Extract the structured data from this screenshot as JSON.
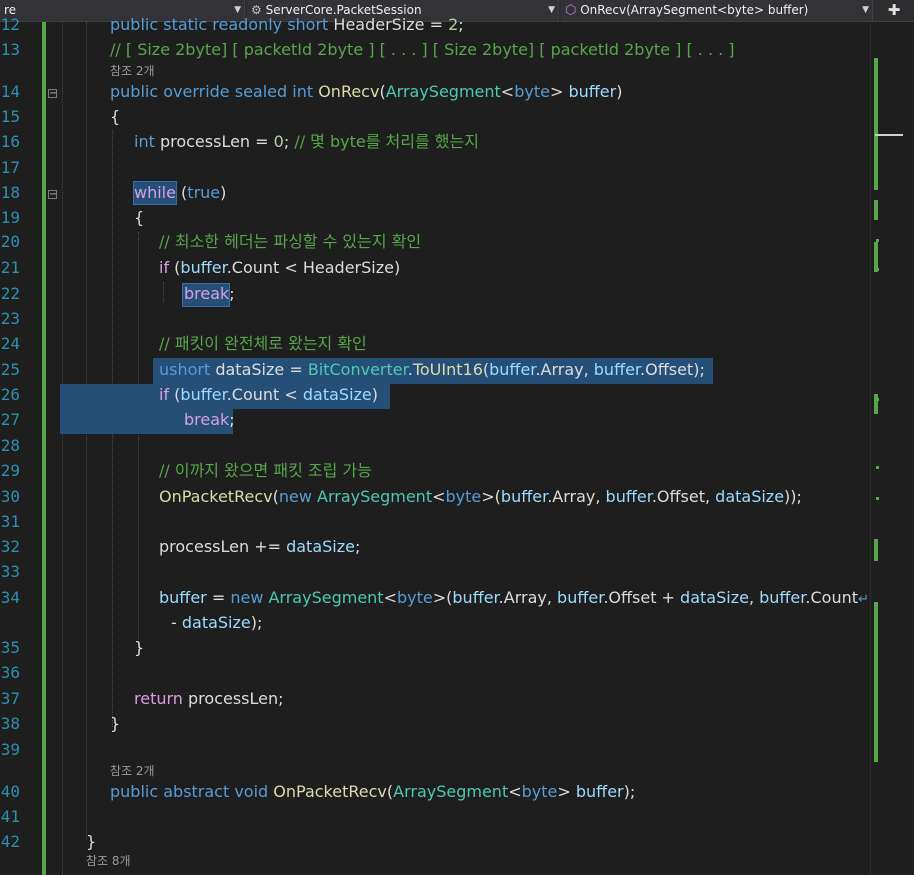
{
  "navbar": {
    "project": "re",
    "class_scope": "ServerCore.PacketSession",
    "member_scope": "OnRecv(ArraySegment<byte> buffer)",
    "split_icon": "split-view-icon"
  },
  "code_lens": {
    "ref2": "참조 2개",
    "ref8": "참조 8개"
  },
  "lines": [
    {
      "n": "12",
      "parts": [
        [
          "kw",
          "public static readonly short "
        ],
        [
          "",
          "HeaderSize = "
        ],
        [
          "nm",
          "2"
        ],
        [
          "",
          ";"
        ]
      ]
    },
    {
      "n": "13",
      "parts": [
        [
          "cm",
          "// [ Size 2byte] [ packetId 2byte ] [ . . . ] [ Size 2byte] [ packetId 2byte ] [ . . . ]"
        ]
      ]
    },
    {
      "n": "14",
      "parts": [
        [
          "kw",
          "public override sealed int "
        ],
        [
          "mt",
          "OnRecv"
        ],
        [
          "",
          "("
        ],
        [
          "ty",
          "ArraySegment"
        ],
        [
          "",
          "<"
        ],
        [
          "kw",
          "byte"
        ],
        [
          "",
          "> "
        ],
        [
          "pa",
          "buffer"
        ],
        [
          "",
          ")"
        ]
      ]
    },
    {
      "n": "15",
      "parts": [
        [
          "",
          "{"
        ]
      ]
    },
    {
      "n": "16",
      "parts": [
        [
          "kw",
          "int "
        ],
        [
          "",
          "processLen = "
        ],
        [
          "nm",
          "0"
        ],
        [
          "",
          "; "
        ],
        [
          "cm",
          "// 몇 byte를 처리를 했는지"
        ]
      ]
    },
    {
      "n": "17",
      "parts": []
    },
    {
      "n": "18",
      "parts": [
        [
          "kc",
          "while"
        ],
        [
          "",
          " ("
        ],
        [
          "kw",
          "true"
        ],
        [
          "",
          ")"
        ]
      ]
    },
    {
      "n": "19",
      "parts": [
        [
          "",
          "{"
        ]
      ]
    },
    {
      "n": "20",
      "parts": [
        [
          "cm",
          "// 최소한 헤더는 파싱할 수 있는지 확인"
        ]
      ]
    },
    {
      "n": "21",
      "parts": [
        [
          "kc",
          "if"
        ],
        [
          "",
          " ("
        ],
        [
          "pa",
          "buffer"
        ],
        [
          "",
          ".Count < HeaderSize)"
        ]
      ]
    },
    {
      "n": "22",
      "parts": [
        [
          "kc",
          "break"
        ],
        [
          "",
          ";"
        ]
      ]
    },
    {
      "n": "23",
      "parts": []
    },
    {
      "n": "24",
      "parts": [
        [
          "cm",
          "// 패킷이 완전체로 왔는지 확인"
        ]
      ]
    },
    {
      "n": "25",
      "parts": [
        [
          "kw",
          "ushort "
        ],
        [
          "",
          "dataSize = "
        ],
        [
          "ty",
          "BitConverter"
        ],
        [
          "",
          "."
        ],
        [
          "mt",
          "ToUInt16"
        ],
        [
          "",
          "("
        ],
        [
          "pa",
          "buffer"
        ],
        [
          "",
          ".Array, "
        ],
        [
          "pa",
          "buffer"
        ],
        [
          "",
          ".Offset);"
        ]
      ]
    },
    {
      "n": "26",
      "parts": [
        [
          "kc",
          "if"
        ],
        [
          "",
          " ("
        ],
        [
          "pa",
          "buffer"
        ],
        [
          "",
          ".Count < "
        ],
        [
          "pa",
          "dataSize"
        ],
        [
          "",
          ")"
        ]
      ]
    },
    {
      "n": "27",
      "parts": [
        [
          "kc",
          "break"
        ],
        [
          "",
          ";"
        ]
      ]
    },
    {
      "n": "28",
      "parts": []
    },
    {
      "n": "29",
      "parts": [
        [
          "cm",
          "// 이까지 왔으면 패킷 조립 가능"
        ]
      ]
    },
    {
      "n": "30",
      "parts": [
        [
          "mt",
          "OnPacketRecv"
        ],
        [
          "",
          "("
        ],
        [
          "kw",
          "new "
        ],
        [
          "ty",
          "ArraySegment"
        ],
        [
          "",
          "<"
        ],
        [
          "kw",
          "byte"
        ],
        [
          "",
          ">("
        ],
        [
          "pa",
          "buffer"
        ],
        [
          "",
          ".Array, "
        ],
        [
          "pa",
          "buffer"
        ],
        [
          "",
          ".Offset, "
        ],
        [
          "pa",
          "dataSize"
        ],
        [
          "",
          "));"
        ]
      ]
    },
    {
      "n": "31",
      "parts": []
    },
    {
      "n": "32",
      "parts": [
        [
          "",
          "processLen += "
        ],
        [
          "pa",
          "dataSize"
        ],
        [
          "",
          ";"
        ]
      ]
    },
    {
      "n": "33",
      "parts": []
    },
    {
      "n": "34",
      "parts": [
        [
          "pa",
          "buffer"
        ],
        [
          "",
          " = "
        ],
        [
          "kw",
          "new "
        ],
        [
          "ty",
          "ArraySegment"
        ],
        [
          "",
          "<"
        ],
        [
          "kw",
          "byte"
        ],
        [
          "",
          ">("
        ],
        [
          "pa",
          "buffer"
        ],
        [
          "",
          ".Array, "
        ],
        [
          "pa",
          "buffer"
        ],
        [
          "",
          ".Offset + "
        ],
        [
          "pa",
          "dataSize"
        ],
        [
          "",
          ", "
        ],
        [
          "pa",
          "buffer"
        ],
        [
          "",
          ".Count"
        ]
      ]
    },
    {
      "n": "",
      "parts": [
        [
          "",
          "- "
        ],
        [
          "pa",
          "dataSize"
        ],
        [
          "",
          ");"
        ]
      ]
    },
    {
      "n": "35",
      "parts": [
        [
          "",
          "}"
        ]
      ]
    },
    {
      "n": "36",
      "parts": []
    },
    {
      "n": "37",
      "parts": [
        [
          "kc",
          "return "
        ],
        [
          "",
          "processLen;"
        ]
      ]
    },
    {
      "n": "38",
      "parts": [
        [
          "",
          "}"
        ]
      ]
    },
    {
      "n": "39",
      "parts": []
    },
    {
      "n": "40",
      "parts": [
        [
          "kw",
          "public abstract void "
        ],
        [
          "mt",
          "OnPacketRecv"
        ],
        [
          "",
          "("
        ],
        [
          "ty",
          "ArraySegment"
        ],
        [
          "",
          "<"
        ],
        [
          "kw",
          "byte"
        ],
        [
          "",
          "> "
        ],
        [
          "pa",
          "buffer"
        ],
        [
          "",
          ");"
        ]
      ]
    },
    {
      "n": "41",
      "parts": []
    },
    {
      "n": "42",
      "parts": [
        [
          "",
          "}"
        ]
      ]
    }
  ]
}
